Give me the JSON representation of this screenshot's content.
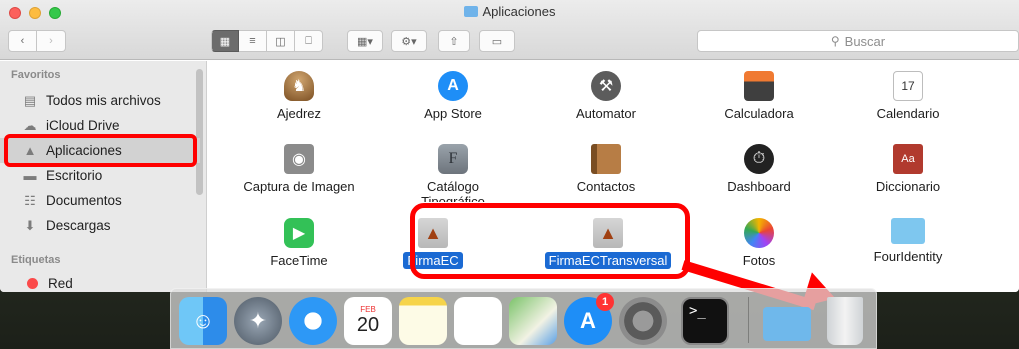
{
  "window": {
    "title": "Aplicaciones",
    "search_placeholder": "Buscar"
  },
  "sidebar": {
    "favorites_heading": "Favoritos",
    "tags_heading": "Etiquetas",
    "items": [
      {
        "label": "Todos mis archivos",
        "icon": "all-files-icon"
      },
      {
        "label": "iCloud Drive",
        "icon": "cloud-icon"
      },
      {
        "label": "Aplicaciones",
        "icon": "applications-icon",
        "selected": true
      },
      {
        "label": "Escritorio",
        "icon": "desktop-icon"
      },
      {
        "label": "Documentos",
        "icon": "documents-icon"
      },
      {
        "label": "Descargas",
        "icon": "downloads-icon"
      }
    ],
    "tag_items": [
      {
        "label": "Red",
        "color": "#fb4a4a"
      }
    ]
  },
  "apps": [
    {
      "label": "Ajedrez",
      "icon": "chess-icon"
    },
    {
      "label": "App Store",
      "icon": "app-store-icon"
    },
    {
      "label": "Automator",
      "icon": "automator-icon"
    },
    {
      "label": "Calculadora",
      "icon": "calculator-icon"
    },
    {
      "label": "Calendario",
      "icon": "calendar-icon",
      "day": "17"
    },
    {
      "label": "Captura de Imagen",
      "icon": "image-capture-icon"
    },
    {
      "label": "Catálogo Tipográfico",
      "icon": "font-book-icon",
      "glyph": "F"
    },
    {
      "label": "Contactos",
      "icon": "contacts-icon"
    },
    {
      "label": "Dashboard",
      "icon": "dashboard-icon"
    },
    {
      "label": "Diccionario",
      "icon": "dictionary-icon",
      "glyph": "Aa"
    },
    {
      "label": "FaceTime",
      "icon": "facetime-icon"
    },
    {
      "label": "FirmaEC",
      "icon": "firmaec-icon",
      "selected": true
    },
    {
      "label": "FirmaECTransversal",
      "icon": "firmaec-transversal-icon",
      "selected": true
    },
    {
      "label": "Fotos",
      "icon": "photos-icon"
    },
    {
      "label": "FourIdentity",
      "icon": "folder-icon"
    }
  ],
  "dock": {
    "calendar_month": "FEB",
    "calendar_day": "20",
    "app_store_badge": "1",
    "terminal_prompt": ">_",
    "items": [
      "finder-icon",
      "launchpad-icon",
      "safari-icon",
      "calendar-icon",
      "notes-icon",
      "reminders-icon",
      "maps-icon",
      "app-store-icon",
      "system-preferences-icon",
      "terminal-icon",
      "folder-icon",
      "trash-icon"
    ]
  },
  "colors": {
    "annotation": "#ff0000",
    "selection": "#1b6ad3"
  }
}
